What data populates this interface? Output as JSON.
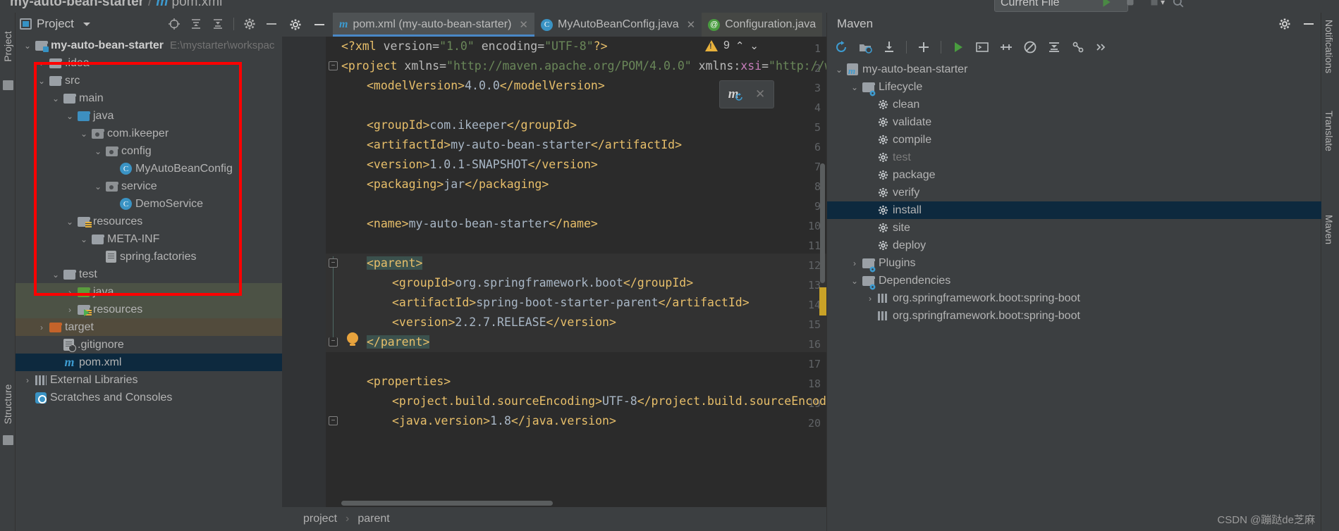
{
  "window": {
    "breadcrumb_project": "my-auto-bean-starter",
    "breadcrumb_sep": "/",
    "breadcrumb_file": "pom.xml",
    "run_config": "Current File"
  },
  "left_toolbars": {
    "project_label": "Project",
    "structure_label": "Structure"
  },
  "right_toolbars": {
    "notifications_label": "Notifications",
    "translate_label": "Translate",
    "maven_label": "Maven"
  },
  "project_panel": {
    "title": "Project",
    "tree": [
      {
        "label": "my-auto-bean-starter",
        "path": "E:\\mystarter\\workspac",
        "indent": 0,
        "arrow": "down",
        "icon": "module-folder",
        "bold": true,
        "state": "none"
      },
      {
        "label": ".idea",
        "path": "",
        "indent": 1,
        "arrow": "right",
        "icon": "folder",
        "bold": false,
        "state": "none"
      },
      {
        "label": "src",
        "path": "",
        "indent": 1,
        "arrow": "down",
        "icon": "folder",
        "bold": false,
        "state": "none"
      },
      {
        "label": "main",
        "path": "",
        "indent": 2,
        "arrow": "down",
        "icon": "folder",
        "bold": false,
        "state": "none"
      },
      {
        "label": "java",
        "path": "",
        "indent": 3,
        "arrow": "down",
        "icon": "folder-blue",
        "bold": false,
        "state": "none"
      },
      {
        "label": "com.ikeeper",
        "path": "",
        "indent": 4,
        "arrow": "down",
        "icon": "package",
        "bold": false,
        "state": "none"
      },
      {
        "label": "config",
        "path": "",
        "indent": 5,
        "arrow": "down",
        "icon": "package",
        "bold": false,
        "state": "none"
      },
      {
        "label": "MyAutoBeanConfig",
        "path": "",
        "indent": 6,
        "arrow": "none",
        "icon": "class",
        "bold": false,
        "state": "none"
      },
      {
        "label": "service",
        "path": "",
        "indent": 5,
        "arrow": "down",
        "icon": "package",
        "bold": false,
        "state": "none"
      },
      {
        "label": "DemoService",
        "path": "",
        "indent": 6,
        "arrow": "none",
        "icon": "class",
        "bold": false,
        "state": "none"
      },
      {
        "label": "resources",
        "path": "",
        "indent": 3,
        "arrow": "down",
        "icon": "folder-resource",
        "bold": false,
        "state": "none"
      },
      {
        "label": "META-INF",
        "path": "",
        "indent": 4,
        "arrow": "down",
        "icon": "folder",
        "bold": false,
        "state": "none"
      },
      {
        "label": "spring.factories",
        "path": "",
        "indent": 5,
        "arrow": "none",
        "icon": "file",
        "bold": false,
        "state": "none"
      },
      {
        "label": "test",
        "path": "",
        "indent": 2,
        "arrow": "down",
        "icon": "folder",
        "bold": false,
        "state": "none"
      },
      {
        "label": "java",
        "path": "",
        "indent": 3,
        "arrow": "right",
        "icon": "folder-green",
        "bold": false,
        "state": "green"
      },
      {
        "label": "resources",
        "path": "",
        "indent": 3,
        "arrow": "right",
        "icon": "folder-test-resource",
        "bold": false,
        "state": "green"
      },
      {
        "label": "target",
        "path": "",
        "indent": 1,
        "arrow": "right",
        "icon": "folder-orange",
        "bold": false,
        "state": "brown"
      },
      {
        "label": ".gitignore",
        "path": "",
        "indent": 2,
        "arrow": "none",
        "icon": "file-git",
        "bold": false,
        "state": "none"
      },
      {
        "label": "pom.xml",
        "path": "",
        "indent": 2,
        "arrow": "none",
        "icon": "maven",
        "bold": false,
        "state": "blue"
      },
      {
        "label": "External Libraries",
        "path": "",
        "indent": 0,
        "arrow": "right",
        "icon": "libraries",
        "bold": false,
        "state": "none"
      },
      {
        "label": "Scratches and Consoles",
        "path": "",
        "indent": 0,
        "arrow": "none",
        "icon": "scratches",
        "bold": false,
        "state": "none"
      }
    ]
  },
  "editor": {
    "tabs": [
      {
        "label": "pom.xml (my-auto-bean-starter)",
        "icon": "maven-icon",
        "active": true,
        "closable": true
      },
      {
        "label": "MyAutoBeanConfig.java",
        "icon": "class-icon",
        "active": false,
        "closable": true
      },
      {
        "label": "Configuration.java",
        "icon": "annotation-icon",
        "active": false,
        "closable": false
      }
    ],
    "inspection_count": "9",
    "breadcrumb": [
      "project",
      "parent"
    ],
    "lines": [
      {
        "n": "1",
        "segments": [
          {
            "t": "<?xml ",
            "c": "tagpunct"
          },
          {
            "t": "version",
            "c": "attr"
          },
          {
            "t": "=",
            "c": "attr"
          },
          {
            "t": "\"1.0\"",
            "c": "attrv"
          },
          {
            "t": " ",
            "c": "txt"
          },
          {
            "t": "encoding",
            "c": "attr"
          },
          {
            "t": "=",
            "c": "attr"
          },
          {
            "t": "\"UTF-8\"",
            "c": "attrv"
          },
          {
            "t": "?>",
            "c": "tagpunct"
          }
        ],
        "indent": 0
      },
      {
        "n": "2",
        "segments": [
          {
            "t": "<project",
            "c": "tagname"
          },
          {
            "t": " ",
            "c": "txt"
          },
          {
            "t": "xmlns",
            "c": "attr"
          },
          {
            "t": "=",
            "c": "attr"
          },
          {
            "t": "\"http://maven.apache.org/POM/4.0.0\"",
            "c": "attrv"
          },
          {
            "t": " ",
            "c": "txt"
          },
          {
            "t": "xmlns:",
            "c": "attr"
          },
          {
            "t": "xsi",
            "c": "xsi"
          },
          {
            "t": "=",
            "c": "attr"
          },
          {
            "t": "\"http://w",
            "c": "attrv"
          }
        ],
        "indent": 0
      },
      {
        "n": "3",
        "segments": [
          {
            "t": "<modelVersion>",
            "c": "tagname"
          },
          {
            "t": "4.0.0",
            "c": "txt"
          },
          {
            "t": "</modelVersion>",
            "c": "tagname"
          }
        ],
        "indent": 1
      },
      {
        "n": "4",
        "segments": [],
        "indent": 0
      },
      {
        "n": "5",
        "segments": [
          {
            "t": "<groupId>",
            "c": "tagname"
          },
          {
            "t": "com.ikeeper",
            "c": "txt"
          },
          {
            "t": "</groupId>",
            "c": "tagname"
          }
        ],
        "indent": 1
      },
      {
        "n": "6",
        "segments": [
          {
            "t": "<artifactId>",
            "c": "tagname"
          },
          {
            "t": "my-auto-bean-starter",
            "c": "txt"
          },
          {
            "t": "</artifactId>",
            "c": "tagname"
          }
        ],
        "indent": 1
      },
      {
        "n": "7",
        "segments": [
          {
            "t": "<version>",
            "c": "tagname"
          },
          {
            "t": "1.0.1-SNAPSHOT",
            "c": "txt"
          },
          {
            "t": "</version>",
            "c": "tagname"
          }
        ],
        "indent": 1
      },
      {
        "n": "8",
        "segments": [
          {
            "t": "<packaging>",
            "c": "tagname"
          },
          {
            "t": "jar",
            "c": "txt"
          },
          {
            "t": "</packaging>",
            "c": "tagname"
          }
        ],
        "indent": 1
      },
      {
        "n": "9",
        "segments": [],
        "indent": 0
      },
      {
        "n": "10",
        "segments": [
          {
            "t": "<name>",
            "c": "tagname"
          },
          {
            "t": "my-auto-bean-starter",
            "c": "txt"
          },
          {
            "t": "</name>",
            "c": "tagname"
          }
        ],
        "indent": 1
      },
      {
        "n": "11",
        "segments": [],
        "indent": 0
      },
      {
        "n": "12",
        "segments": [
          {
            "t": "<parent>",
            "c": "tagname hl-match"
          }
        ],
        "indent": 1
      },
      {
        "n": "13",
        "segments": [
          {
            "t": "<groupId>",
            "c": "tagname"
          },
          {
            "t": "org.springframework.boot",
            "c": "txt"
          },
          {
            "t": "</groupId>",
            "c": "tagname"
          }
        ],
        "indent": 2
      },
      {
        "n": "14",
        "segments": [
          {
            "t": "<artifactId>",
            "c": "tagname"
          },
          {
            "t": "spring-boot-starter-parent",
            "c": "txt"
          },
          {
            "t": "</artifactId>",
            "c": "tagname"
          }
        ],
        "indent": 2
      },
      {
        "n": "15",
        "segments": [
          {
            "t": "<version>",
            "c": "tagname"
          },
          {
            "t": "2.2.7.RELEASE",
            "c": "txt"
          },
          {
            "t": "</version>",
            "c": "tagname"
          }
        ],
        "indent": 2
      },
      {
        "n": "16",
        "segments": [
          {
            "t": "</parent>",
            "c": "tagname hl-match"
          }
        ],
        "indent": 1
      },
      {
        "n": "17",
        "segments": [],
        "indent": 0
      },
      {
        "n": "18",
        "segments": [
          {
            "t": "<properties>",
            "c": "tagname"
          }
        ],
        "indent": 1
      },
      {
        "n": "19",
        "segments": [
          {
            "t": "<project.build.sourceEncoding>",
            "c": "tagname"
          },
          {
            "t": "UTF-8",
            "c": "txt"
          },
          {
            "t": "</project.build.sourceEncod",
            "c": "tagname"
          }
        ],
        "indent": 2
      },
      {
        "n": "20",
        "segments": [
          {
            "t": "<java.version>",
            "c": "tagname"
          },
          {
            "t": "1.8",
            "c": "txt"
          },
          {
            "t": "</java.version>",
            "c": "tagname"
          }
        ],
        "indent": 2
      }
    ]
  },
  "maven_panel": {
    "title": "Maven",
    "tree": [
      {
        "label": "my-auto-bean-starter",
        "indent": 0,
        "arrow": "down",
        "icon": "maven-project",
        "state": "none"
      },
      {
        "label": "Lifecycle",
        "indent": 1,
        "arrow": "down",
        "icon": "phase-folder",
        "state": "none"
      },
      {
        "label": "clean",
        "indent": 2,
        "arrow": "none",
        "icon": "gear",
        "state": "none"
      },
      {
        "label": "validate",
        "indent": 2,
        "arrow": "none",
        "icon": "gear",
        "state": "none"
      },
      {
        "label": "compile",
        "indent": 2,
        "arrow": "none",
        "icon": "gear",
        "state": "none"
      },
      {
        "label": "test",
        "indent": 2,
        "arrow": "none",
        "icon": "gear",
        "state": "dim"
      },
      {
        "label": "package",
        "indent": 2,
        "arrow": "none",
        "icon": "gear",
        "state": "none"
      },
      {
        "label": "verify",
        "indent": 2,
        "arrow": "none",
        "icon": "gear",
        "state": "none"
      },
      {
        "label": "install",
        "indent": 2,
        "arrow": "none",
        "icon": "gear",
        "state": "selected"
      },
      {
        "label": "site",
        "indent": 2,
        "arrow": "none",
        "icon": "gear",
        "state": "none"
      },
      {
        "label": "deploy",
        "indent": 2,
        "arrow": "none",
        "icon": "gear",
        "state": "none"
      },
      {
        "label": "Plugins",
        "indent": 1,
        "arrow": "right",
        "icon": "phase-folder",
        "state": "none"
      },
      {
        "label": "Dependencies",
        "indent": 1,
        "arrow": "down",
        "icon": "phase-folder",
        "state": "none"
      },
      {
        "label": "org.springframework.boot:spring-boot",
        "indent": 2,
        "arrow": "right",
        "icon": "bars",
        "state": "none"
      },
      {
        "label": "org.springframework.boot:spring-boot",
        "indent": 2,
        "arrow": "none",
        "icon": "bars",
        "state": "none"
      }
    ]
  },
  "watermark": "CSDN @蹦跶de芝麻",
  "colors": {
    "accent": "#4a88c7",
    "selection_blue": "#0d293e",
    "selection_green": "#4c5245",
    "selection_brown": "#524b3c",
    "annotation_red": "#ff0000",
    "warning_yellow": "#e8b13b",
    "editor_bg": "#2b2b2b",
    "panel_bg": "#3c3f41"
  }
}
